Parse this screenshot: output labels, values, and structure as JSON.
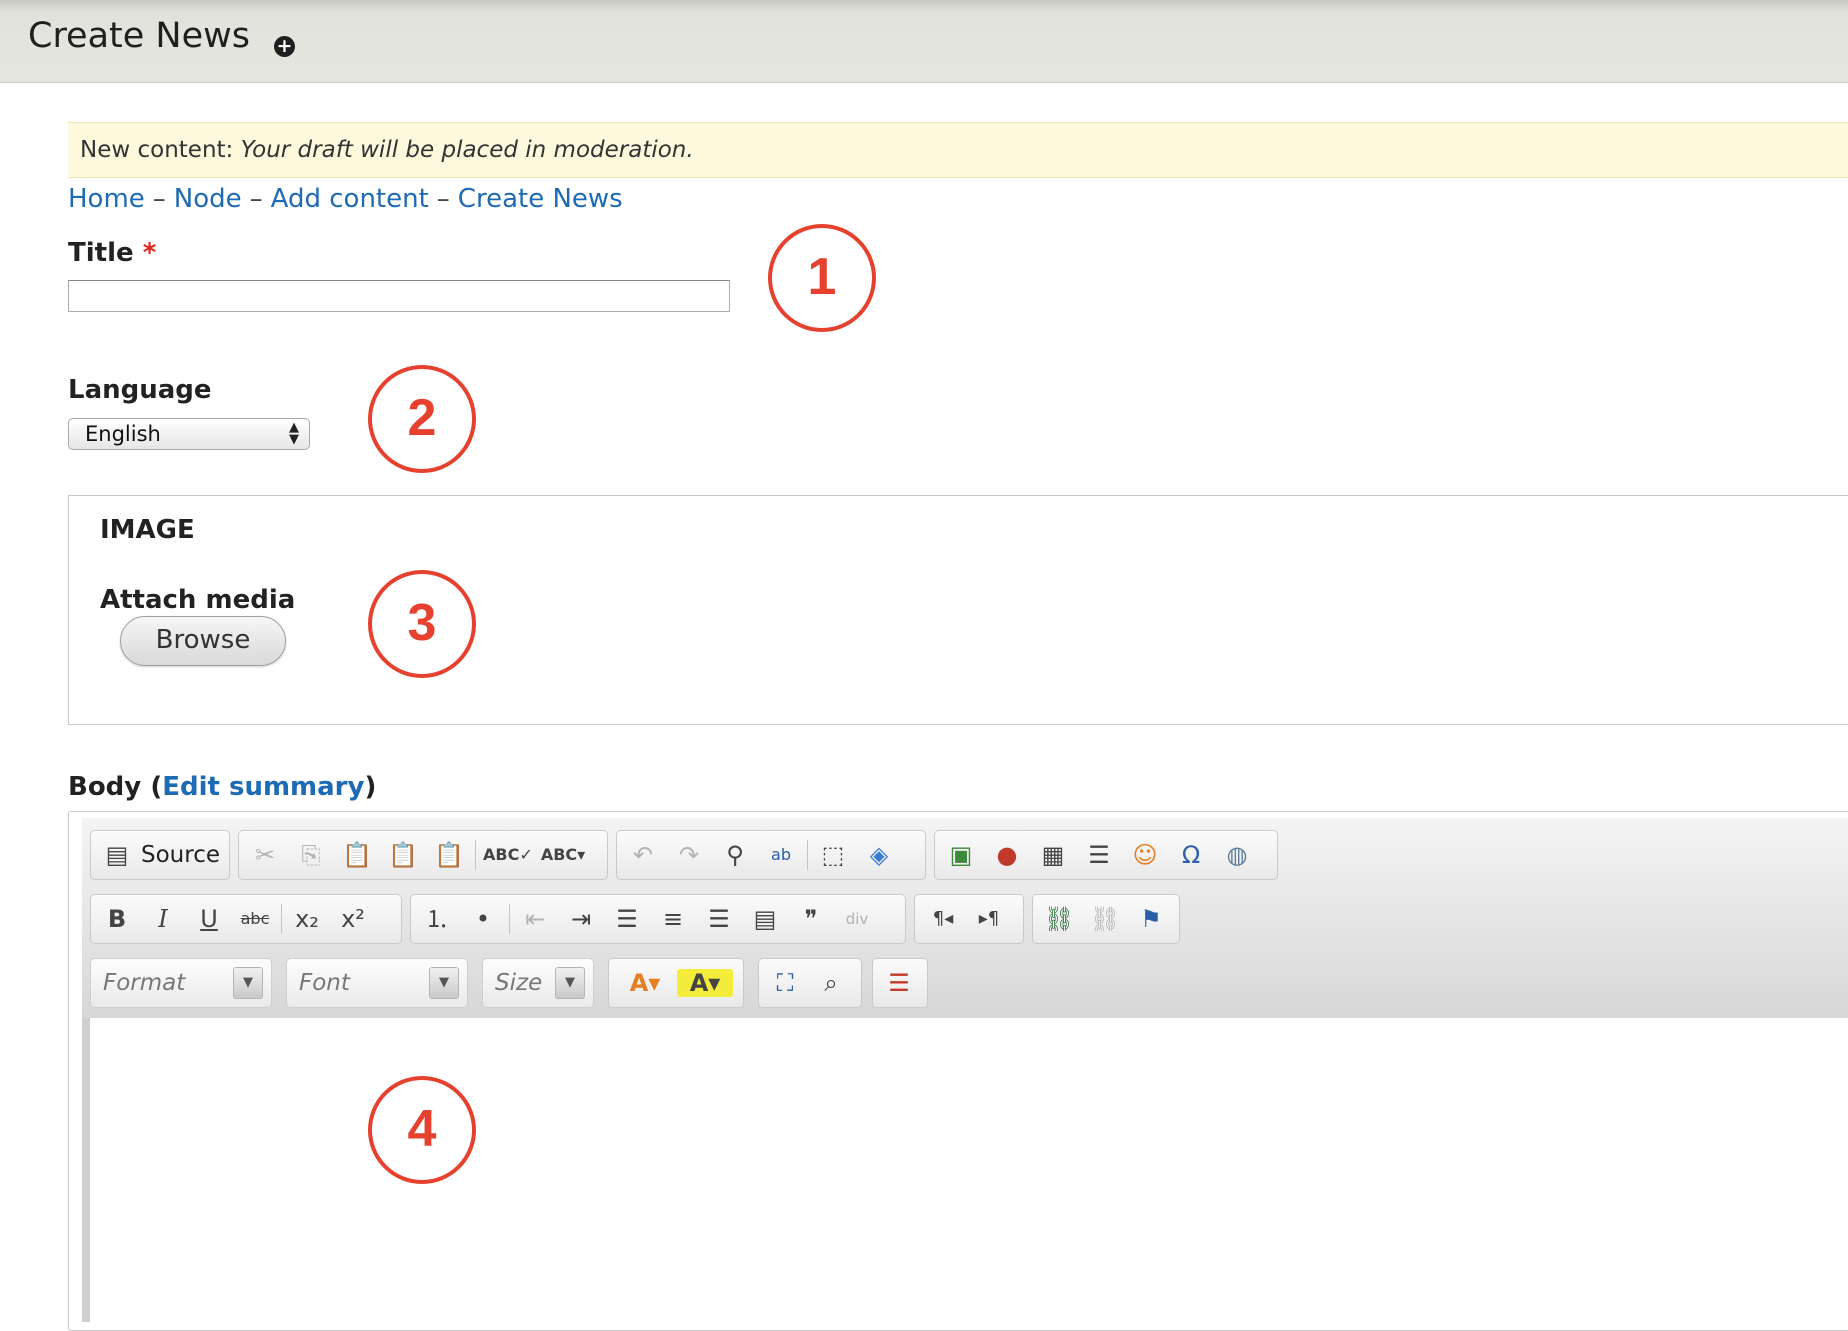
{
  "header": {
    "title": "Create News",
    "plus_icon": "plus-circle-icon"
  },
  "notice": {
    "label": "New content: ",
    "message": "Your draft will be placed in moderation."
  },
  "breadcrumb": {
    "items": [
      "Home",
      "Node",
      "Add content",
      "Create News"
    ],
    "separator": "–"
  },
  "form": {
    "title_label": "Title",
    "required_marker": "*",
    "title_value": "",
    "language_label": "Language",
    "language_value": "English",
    "image_legend": "IMAGE",
    "attach_label": "Attach media",
    "browse_label": "Browse",
    "body_label": "Body",
    "edit_summary": "Edit summary",
    "body_paren_open": "(",
    "body_paren_close": ")"
  },
  "editor": {
    "source_label": "Source",
    "format_placeholder": "Format",
    "font_placeholder": "Font",
    "size_placeholder": "Size"
  },
  "annotations": [
    "1",
    "2",
    "3",
    "4"
  ],
  "colors": {
    "link": "#1d6bb5",
    "required": "#e0261d",
    "annotation": "#e6412f",
    "notice_bg": "#fdf9dd"
  }
}
